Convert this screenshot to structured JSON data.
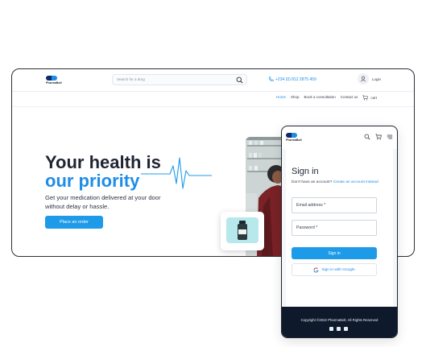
{
  "desktop": {
    "logo_text": "PharmaBolt",
    "search_placeholder": "Search for a drug",
    "phone": "+234 (0) 812 2875 459",
    "login_label": "Login",
    "nav": [
      "Home",
      "Shop",
      "Book a consultation",
      "Contact us",
      "cart"
    ],
    "hero_title_line1": "Your health is",
    "hero_title_line2": "our priority",
    "hero_subtitle": "Get your medication delivered at your door without delay or hassle.",
    "cta_label": "Place an order"
  },
  "mobile": {
    "logo_text": "PharmaBolt",
    "title": "Sign in",
    "subtitle_prefix": "Don't have an account?",
    "subtitle_link": "Create an account instead",
    "email_placeholder": "Email address *",
    "password_placeholder": "Password *",
    "signin_label": "Sign in",
    "google_label": "Sign in with Google",
    "footer_copyright": "Copyright ©2022 PharmaBolt. All Rights Reserved"
  },
  "colors": {
    "brand_blue": "#1e9be8",
    "navy": "#0d2b6b",
    "footer_bg": "#0e1a2b"
  },
  "icons": [
    "search-icon",
    "phone-icon",
    "user-icon",
    "cart-icon",
    "menu-icon",
    "google-icon",
    "facebook-icon",
    "twitter-icon",
    "linkedin-icon"
  ]
}
